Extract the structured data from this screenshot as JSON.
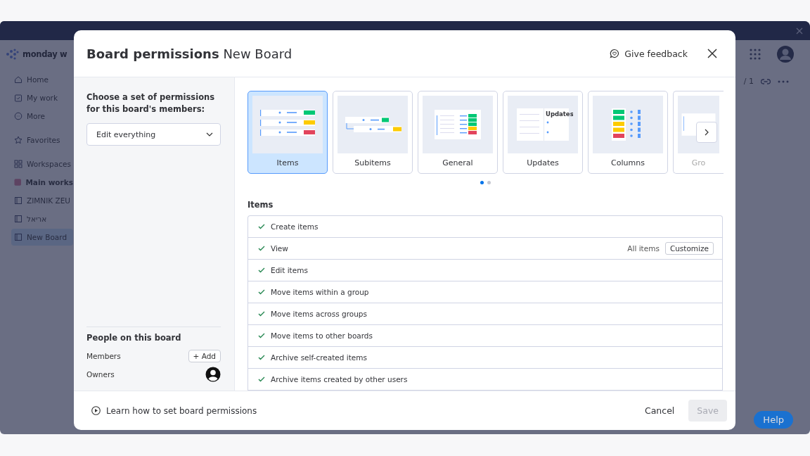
{
  "background_app": {
    "logo": "monday w",
    "sidebar": [
      {
        "label": "Home",
        "kind": "home",
        "selected": false
      },
      {
        "label": "My work",
        "kind": "mywork",
        "selected": false
      },
      {
        "label": "More",
        "kind": "more",
        "selected": false
      },
      {
        "label": "Favorites",
        "kind": "favorites",
        "selected": false
      },
      {
        "label": "Workspaces",
        "kind": "workspaces",
        "selected": false
      },
      {
        "label": "Main works",
        "kind": "workspace",
        "selected": false
      },
      {
        "label": "ZIMNIK ZEU",
        "kind": "board",
        "selected": false
      },
      {
        "label": "אריאל",
        "kind": "board",
        "selected": false
      },
      {
        "label": "New Board",
        "kind": "board",
        "selected": true
      }
    ],
    "page_count": "/ 1",
    "help_button": "Help"
  },
  "dialog": {
    "title": "Board permissions",
    "board_name": "New Board",
    "feedback": "Give feedback",
    "prompt": "Choose a set of permissions for this board's members:",
    "dropdown": {
      "value": "Edit everything"
    },
    "people": {
      "heading": "People on this board",
      "members_label": "Members",
      "add_button": "+ Add",
      "owners_label": "Owners"
    },
    "categories": [
      {
        "label": "Items",
        "kind": "items",
        "selected": true
      },
      {
        "label": "Subitems",
        "kind": "subitems",
        "selected": false
      },
      {
        "label": "General",
        "kind": "general",
        "selected": false
      },
      {
        "label": "Updates",
        "kind": "updates",
        "selected": false,
        "preview_title": "Updates"
      },
      {
        "label": "Columns",
        "kind": "columns",
        "selected": false
      },
      {
        "label": "Gro",
        "kind": "groups",
        "selected": false
      }
    ],
    "pages": [
      {
        "selected": true
      },
      {
        "selected": false
      }
    ],
    "section_title": "Items",
    "permissions": [
      {
        "label": "Create items",
        "checked": true
      },
      {
        "label": "View",
        "checked": true,
        "scope": "All items",
        "action": "Customize"
      },
      {
        "label": "Edit items",
        "checked": true
      },
      {
        "label": "Move items within a group",
        "checked": true
      },
      {
        "label": "Move items across groups",
        "checked": true
      },
      {
        "label": "Move items to other boards",
        "checked": true
      },
      {
        "label": "Archive self-created items",
        "checked": true
      },
      {
        "label": "Archive items created by other users",
        "checked": true
      }
    ],
    "footer": {
      "learn_link": "Learn how to set board permissions",
      "cancel": "Cancel",
      "save": {
        "label": "Save",
        "disabled": true
      }
    }
  }
}
